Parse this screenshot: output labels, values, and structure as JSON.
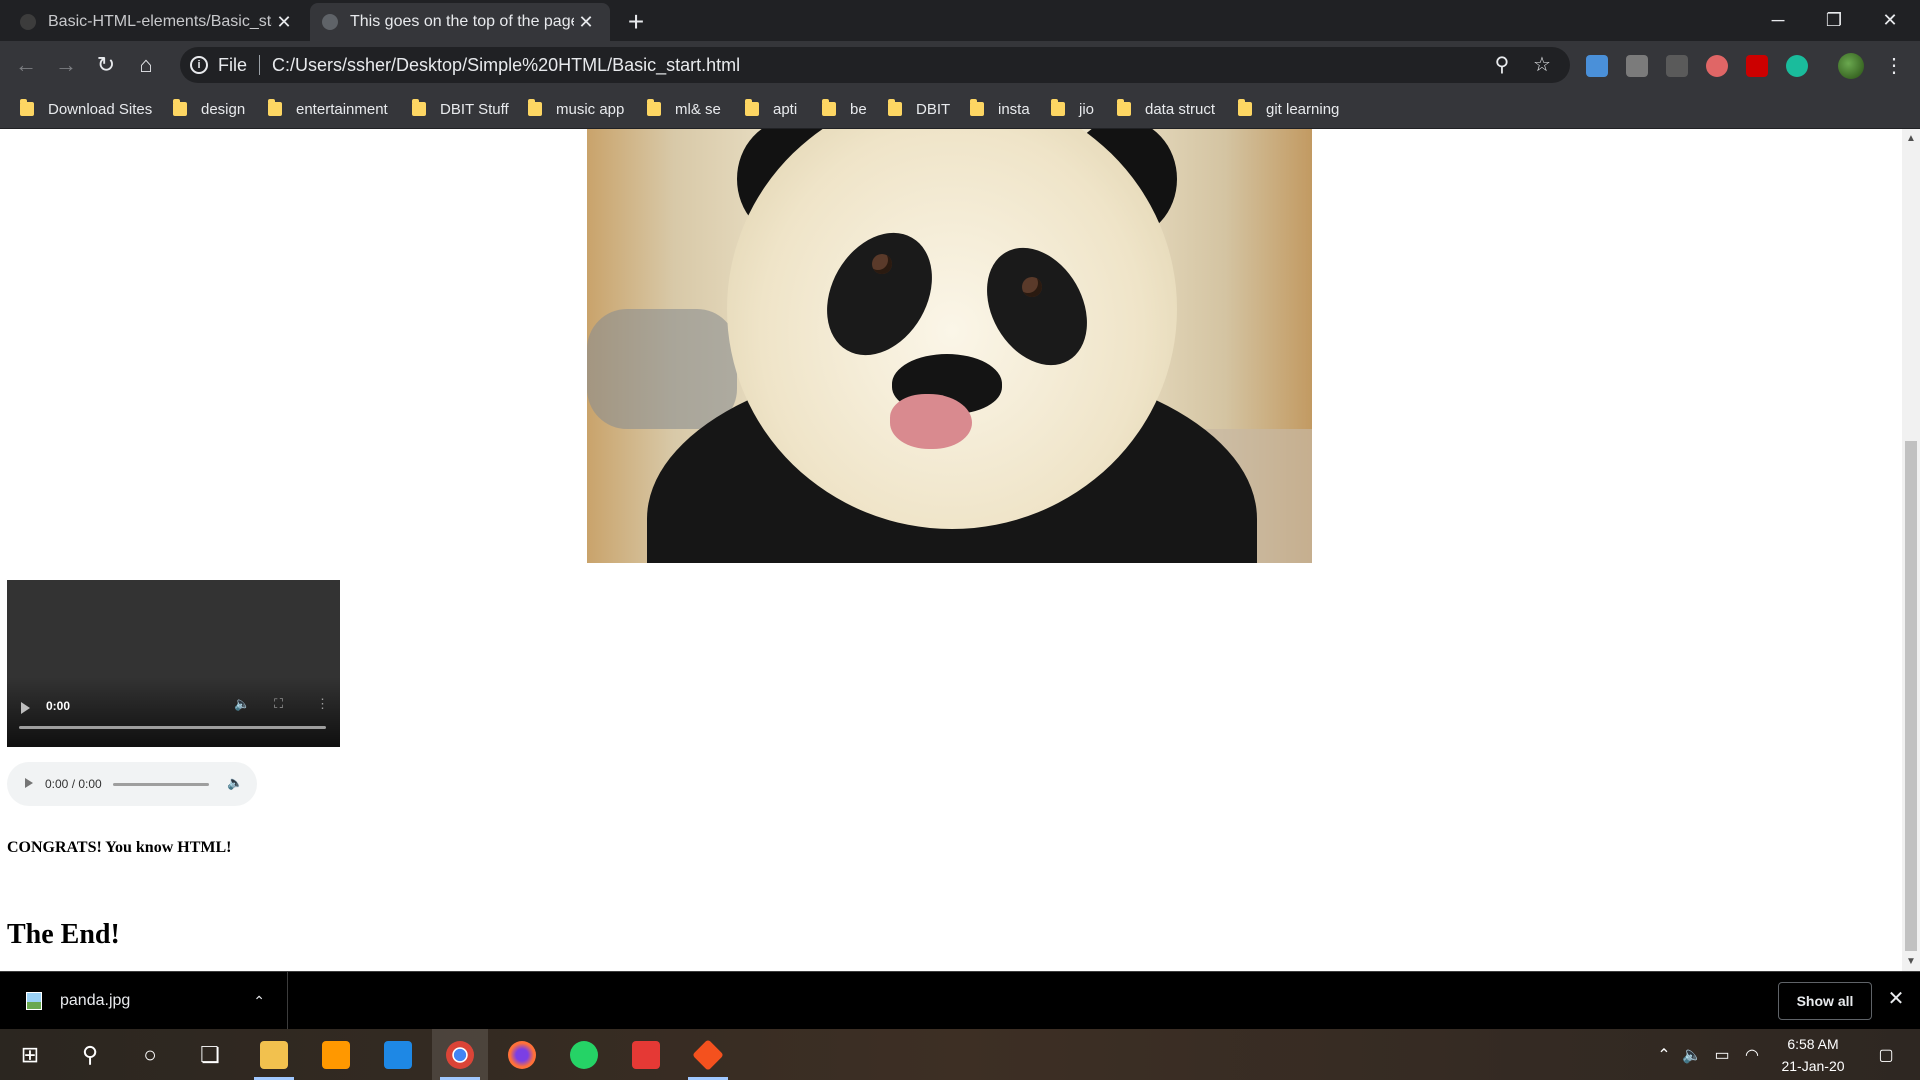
{
  "browser": {
    "tabs": [
      {
        "title": "Basic-HTML-elements/Basic_start",
        "active": false
      },
      {
        "title": "This goes on the top of the page",
        "active": true
      }
    ],
    "new_tab_symbol": "+",
    "window_controls": {
      "minimize": "─",
      "restore": "❐",
      "close": "✕"
    },
    "address": {
      "scheme_label": "File",
      "url": "C:/Users/ssher/Desktop/Simple%20HTML/Basic_start.html"
    },
    "extensions": [
      "extension-1",
      "extension-2",
      "extension-3",
      "extension-4",
      "extension-5",
      "extension-6"
    ]
  },
  "bookmarks": [
    "Download Sites",
    "design",
    "entertainment",
    "DBIT Stuff",
    "music app",
    "ml& se",
    "apti",
    "be",
    "DBIT",
    "insta",
    "jio",
    "data struct",
    "git learning"
  ],
  "page": {
    "image_alt": "panda",
    "video": {
      "time": "0:00"
    },
    "audio": {
      "time": "0:00 / 0:00"
    },
    "congrats": "CONGRATS! You know HTML!",
    "the_end": "The End!"
  },
  "downloads": {
    "file_name": "panda.jpg",
    "show_all": "Show all",
    "close_symbol": "✕"
  },
  "taskbar": {
    "apps": [
      "start",
      "search",
      "cortana",
      "task-view",
      "file-explorer",
      "sublime-text",
      "vscode",
      "chrome",
      "firefox",
      "whatsapp",
      "app-red",
      "app-git"
    ],
    "clock": {
      "time": "6:58 AM",
      "date": "21-Jan-20"
    }
  },
  "colors": {
    "tabstrip": "#202124",
    "toolbar": "#35363a",
    "folder": "#fdd663",
    "video_bg": "#333333",
    "audio_bg": "#f1f3f4"
  }
}
